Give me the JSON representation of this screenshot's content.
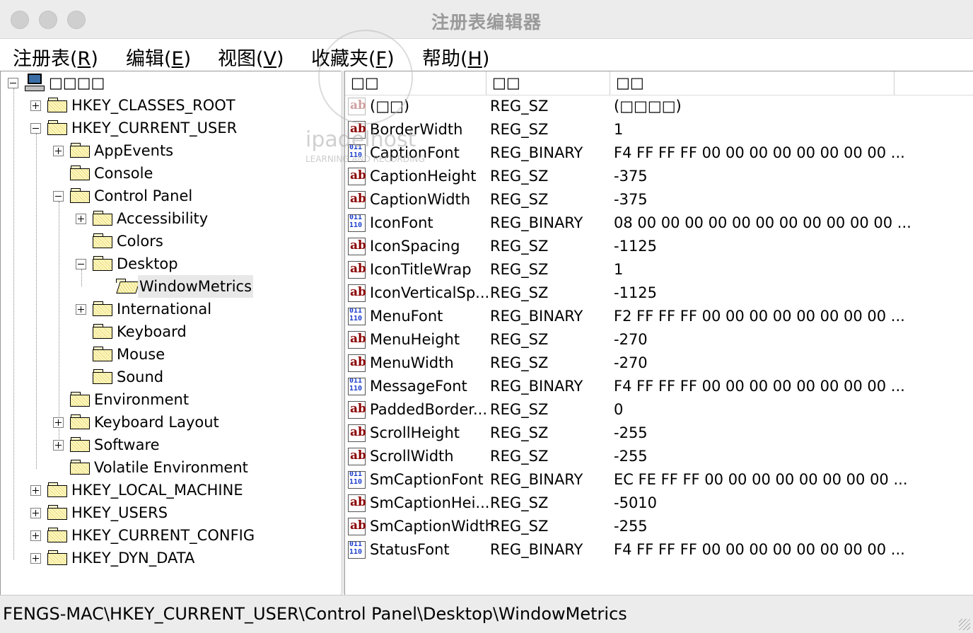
{
  "window": {
    "title": "注册表编辑器"
  },
  "menu": [
    {
      "label": "注册表",
      "accel": "R"
    },
    {
      "label": "编辑",
      "accel": "E"
    },
    {
      "label": "视图",
      "accel": "V"
    },
    {
      "label": "收藏夹",
      "accel": "F"
    },
    {
      "label": "帮助",
      "accel": "H"
    }
  ],
  "tree": {
    "root": "□□□□",
    "nodes": [
      {
        "label": "HKEY_CLASSES_ROOT"
      },
      {
        "label": "HKEY_CURRENT_USER"
      },
      {
        "label": "AppEvents"
      },
      {
        "label": "Console"
      },
      {
        "label": "Control Panel"
      },
      {
        "label": "Accessibility"
      },
      {
        "label": "Colors"
      },
      {
        "label": "Desktop"
      },
      {
        "label": "WindowMetrics"
      },
      {
        "label": "International"
      },
      {
        "label": "Keyboard"
      },
      {
        "label": "Mouse"
      },
      {
        "label": "Sound"
      },
      {
        "label": "Environment"
      },
      {
        "label": "Keyboard Layout"
      },
      {
        "label": "Software"
      },
      {
        "label": "Volatile Environment"
      },
      {
        "label": "HKEY_LOCAL_MACHINE"
      },
      {
        "label": "HKEY_USERS"
      },
      {
        "label": "HKEY_CURRENT_CONFIG"
      },
      {
        "label": "HKEY_DYN_DATA"
      }
    ]
  },
  "list": {
    "columns": [
      "□□",
      "□□",
      "□□"
    ],
    "rows": [
      {
        "icon": "string-value-icon",
        "name": "(□□)",
        "type": "REG_SZ",
        "data": "(□□□□)"
      },
      {
        "icon": "string-value-icon",
        "name": "BorderWidth",
        "type": "REG_SZ",
        "data": "1"
      },
      {
        "icon": "binary-value-icon",
        "name": "CaptionFont",
        "type": "REG_BINARY",
        "data": "F4 FF FF FF 00 00 00 00 00 00 00 00 ..."
      },
      {
        "icon": "string-value-icon",
        "name": "CaptionHeight",
        "type": "REG_SZ",
        "data": "-375"
      },
      {
        "icon": "string-value-icon",
        "name": "CaptionWidth",
        "type": "REG_SZ",
        "data": "-375"
      },
      {
        "icon": "binary-value-icon",
        "name": "IconFont",
        "type": "REG_BINARY",
        "data": "08 00 00 00 00 00 00 00 00 00 00 00 ..."
      },
      {
        "icon": "string-value-icon",
        "name": "IconSpacing",
        "type": "REG_SZ",
        "data": "-1125"
      },
      {
        "icon": "string-value-icon",
        "name": "IconTitleWrap",
        "type": "REG_SZ",
        "data": "1"
      },
      {
        "icon": "string-value-icon",
        "name": "IconVerticalSp...",
        "type": "REG_SZ",
        "data": "-1125"
      },
      {
        "icon": "binary-value-icon",
        "name": "MenuFont",
        "type": "REG_BINARY",
        "data": "F2 FF FF FF 00 00 00 00 00 00 00 00 ..."
      },
      {
        "icon": "string-value-icon",
        "name": "MenuHeight",
        "type": "REG_SZ",
        "data": "-270"
      },
      {
        "icon": "string-value-icon",
        "name": "MenuWidth",
        "type": "REG_SZ",
        "data": "-270"
      },
      {
        "icon": "binary-value-icon",
        "name": "MessageFont",
        "type": "REG_BINARY",
        "data": "F4 FF FF FF 00 00 00 00 00 00 00 00 ..."
      },
      {
        "icon": "string-value-icon",
        "name": "PaddedBorder...",
        "type": "REG_SZ",
        "data": "0"
      },
      {
        "icon": "string-value-icon",
        "name": "ScrollHeight",
        "type": "REG_SZ",
        "data": "-255"
      },
      {
        "icon": "string-value-icon",
        "name": "ScrollWidth",
        "type": "REG_SZ",
        "data": "-255"
      },
      {
        "icon": "binary-value-icon",
        "name": "SmCaptionFont",
        "type": "REG_BINARY",
        "data": "EC FE FF FF 00 00 00 00 00 00 00 00 ..."
      },
      {
        "icon": "string-value-icon",
        "name": "SmCaptionHei...",
        "type": "REG_SZ",
        "data": "-5010"
      },
      {
        "icon": "string-value-icon",
        "name": "SmCaptionWidth",
        "type": "REG_SZ",
        "data": "-255"
      },
      {
        "icon": "binary-value-icon",
        "name": "StatusFont",
        "type": "REG_BINARY",
        "data": "F4 FF FF FF 00 00 00 00 00 00 00 00 ..."
      }
    ]
  },
  "status": {
    "path": "FENGS-MAC\\HKEY_CURRENT_USER\\Control Panel\\Desktop\\WindowMetrics"
  },
  "watermark": {
    "text": "ipadelhost",
    "sub": "LEARNING AND RECORDING"
  }
}
